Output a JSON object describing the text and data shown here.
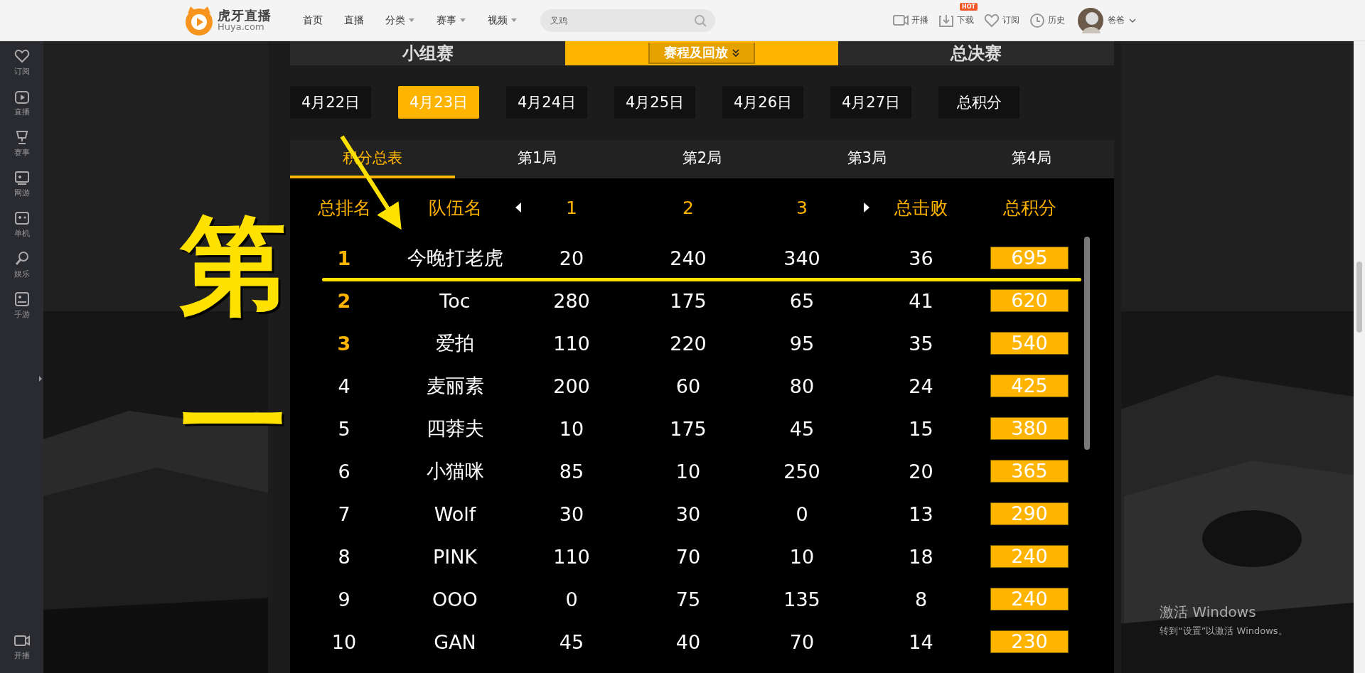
{
  "header": {
    "logo": {
      "name": "虎牙直播",
      "domain": "Huya.com"
    },
    "nav": [
      {
        "label": "首页",
        "dropdown": false
      },
      {
        "label": "直播",
        "dropdown": false
      },
      {
        "label": "分类",
        "dropdown": true
      },
      {
        "label": "赛事",
        "dropdown": true
      },
      {
        "label": "视频",
        "dropdown": true
      }
    ],
    "search": {
      "placeholder": "叉鸡"
    },
    "actions": [
      {
        "label": "开播"
      },
      {
        "label": "下载",
        "badge": "HOT"
      },
      {
        "label": "订阅"
      },
      {
        "label": "历史"
      }
    ],
    "user": {
      "name": "爸爸"
    }
  },
  "sidebar": {
    "items": [
      {
        "label": "订阅"
      },
      {
        "label": "直播"
      },
      {
        "label": "赛事"
      },
      {
        "label": "网游"
      },
      {
        "label": "单机"
      },
      {
        "label": "娱乐"
      },
      {
        "label": "手游"
      }
    ],
    "bottom": {
      "label": "开播"
    }
  },
  "stage_tabs": [
    {
      "label": "小组赛",
      "selected": false
    },
    {
      "label": "赛程及回放",
      "selected": true
    },
    {
      "label": "总决赛",
      "selected": false
    }
  ],
  "dates": [
    {
      "label": "4月22日",
      "selected": false
    },
    {
      "label": "4月23日",
      "selected": true
    },
    {
      "label": "4月24日",
      "selected": false
    },
    {
      "label": "4月25日",
      "selected": false
    },
    {
      "label": "4月26日",
      "selected": false
    },
    {
      "label": "4月27日",
      "selected": false
    },
    {
      "label": "总积分",
      "selected": false
    }
  ],
  "rounds": [
    {
      "label": "积分总表",
      "selected": true
    },
    {
      "label": "第1局",
      "selected": false
    },
    {
      "label": "第2局",
      "selected": false
    },
    {
      "label": "第3局",
      "selected": false
    },
    {
      "label": "第4局",
      "selected": false
    }
  ],
  "table": {
    "columns": [
      "总排名",
      "队伍名",
      "1",
      "2",
      "3",
      "总击败",
      "总积分"
    ],
    "rows": [
      {
        "rank": "1",
        "team": "今晚打老虎",
        "g1": "20",
        "g2": "240",
        "g3": "340",
        "kills": "36",
        "total": "695",
        "highlighted": true
      },
      {
        "rank": "2",
        "team": "Toc",
        "g1": "280",
        "g2": "175",
        "g3": "65",
        "kills": "41",
        "total": "620",
        "highlighted": true
      },
      {
        "rank": "3",
        "team": "爱拍",
        "g1": "110",
        "g2": "220",
        "g3": "95",
        "kills": "35",
        "total": "540",
        "highlighted": true
      },
      {
        "rank": "4",
        "team": "麦丽素",
        "g1": "200",
        "g2": "60",
        "g3": "80",
        "kills": "24",
        "total": "425",
        "highlighted": false
      },
      {
        "rank": "5",
        "team": "四莽夫",
        "g1": "10",
        "g2": "175",
        "g3": "45",
        "kills": "15",
        "total": "380",
        "highlighted": false
      },
      {
        "rank": "6",
        "team": "小猫咪",
        "g1": "85",
        "g2": "10",
        "g3": "250",
        "kills": "20",
        "total": "365",
        "highlighted": false
      },
      {
        "rank": "7",
        "team": "Wolf",
        "g1": "30",
        "g2": "30",
        "g3": "0",
        "kills": "13",
        "total": "290",
        "highlighted": false
      },
      {
        "rank": "8",
        "team": "PINK",
        "g1": "110",
        "g2": "70",
        "g3": "10",
        "kills": "18",
        "total": "240",
        "highlighted": false
      },
      {
        "rank": "9",
        "team": "OOO",
        "g1": "0",
        "g2": "75",
        "g3": "135",
        "kills": "8",
        "total": "240",
        "highlighted": false
      },
      {
        "rank": "10",
        "team": "GAN",
        "g1": "45",
        "g2": "40",
        "g3": "70",
        "kills": "14",
        "total": "230",
        "highlighted": false
      }
    ]
  },
  "annotation": {
    "characters": [
      "第",
      "一"
    ]
  },
  "os_notice": {
    "title": "激活 Windows",
    "hint": "转到“设置”以激活 Windows。"
  }
}
